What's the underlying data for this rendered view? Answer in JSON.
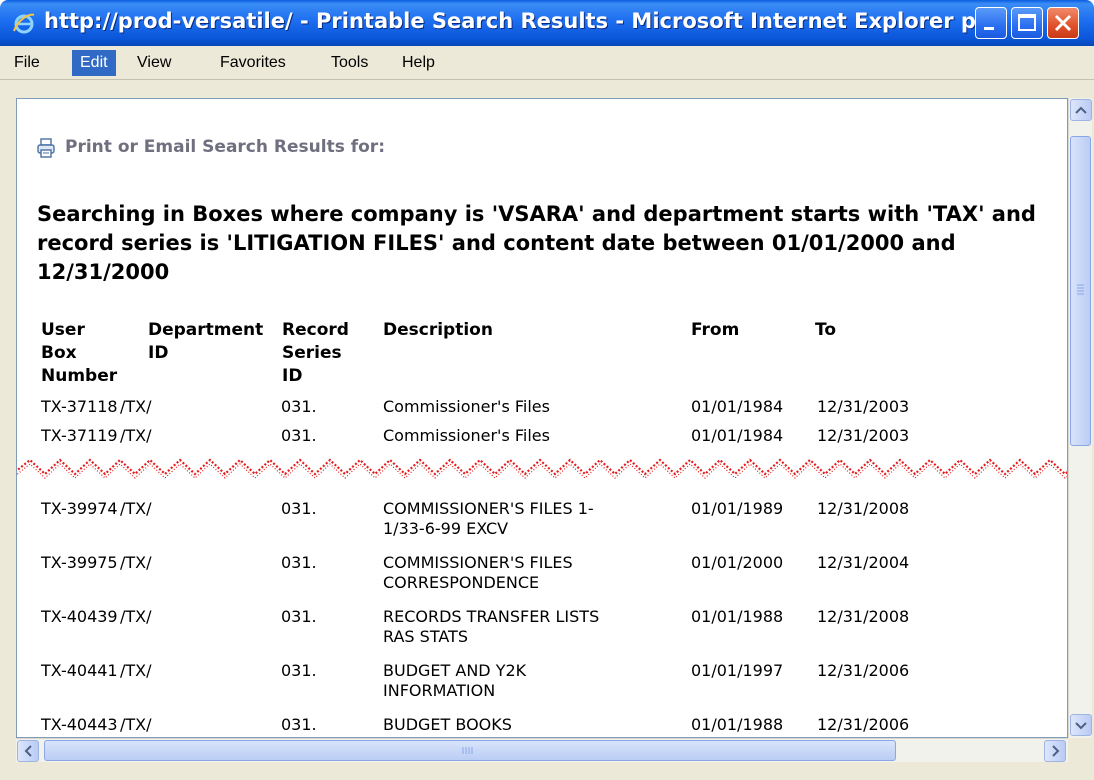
{
  "window": {
    "title": "http://prod-versatile/ - Printable Search Results - Microsoft Internet Explorer p...",
    "colors": {
      "titlebar": "#0a5de0",
      "close_button": "#e0502a",
      "menu_highlight": "#316ac5"
    }
  },
  "menubar": {
    "items": [
      {
        "label": "File"
      },
      {
        "label": "Edit"
      },
      {
        "label": "View"
      },
      {
        "label": "Favorites"
      },
      {
        "label": "Tools"
      },
      {
        "label": "Help"
      }
    ],
    "active": "Edit"
  },
  "page": {
    "print_link": "Print or Email Search Results for:",
    "print_icon": "printer-icon",
    "heading": "Searching in Boxes where company is 'VSARA' and department starts with 'TAX' and record series is 'LITIGATION FILES' and content date between 01/01/2000 and 12/31/2000"
  },
  "table": {
    "headers": [
      [
        "User",
        "Box",
        "Number"
      ],
      [
        "Department",
        "ID"
      ],
      [
        "Record",
        "Series",
        "ID"
      ],
      [
        "Description"
      ],
      [
        "From"
      ],
      [
        "To"
      ]
    ],
    "rows_top": [
      {
        "box": "TX-37118",
        "dept": "/TX/",
        "series": "031.",
        "desc": [
          "Commissioner's Files"
        ],
        "from": "01/01/1984",
        "to": "12/31/2003"
      },
      {
        "box": "TX-37119",
        "dept": "/TX/",
        "series": "031.",
        "desc": [
          "Commissioner's Files"
        ],
        "from": "01/01/1984",
        "to": "12/31/2003"
      }
    ],
    "rows_bottom": [
      {
        "box": "TX-39974",
        "dept": "/TX/",
        "series": "031.",
        "desc": [
          "COMMISSIONER'S FILES 1-",
          "1/33-6-99 EXCV"
        ],
        "from": "01/01/1989",
        "to": "12/31/2008"
      },
      {
        "box": "TX-39975",
        "dept": "/TX/",
        "series": "031.",
        "desc": [
          "COMMISSIONER'S FILES",
          "CORRESPONDENCE"
        ],
        "from": "01/01/2000",
        "to": "12/31/2004"
      },
      {
        "box": "TX-40439",
        "dept": "/TX/",
        "series": "031.",
        "desc": [
          "RECORDS TRANSFER LISTS",
          "RAS STATS"
        ],
        "from": "01/01/1988",
        "to": "12/31/2008"
      },
      {
        "box": "TX-40441",
        "dept": "/TX/",
        "series": "031.",
        "desc": [
          "BUDGET AND Y2K",
          "INFORMATION"
        ],
        "from": "01/01/1997",
        "to": "12/31/2006"
      },
      {
        "box": "TX-40443",
        "dept": "/TX/",
        "series": "031.",
        "desc": [
          "BUDGET BOOKS"
        ],
        "from": "01/01/1988",
        "to": "12/31/2006"
      }
    ]
  }
}
